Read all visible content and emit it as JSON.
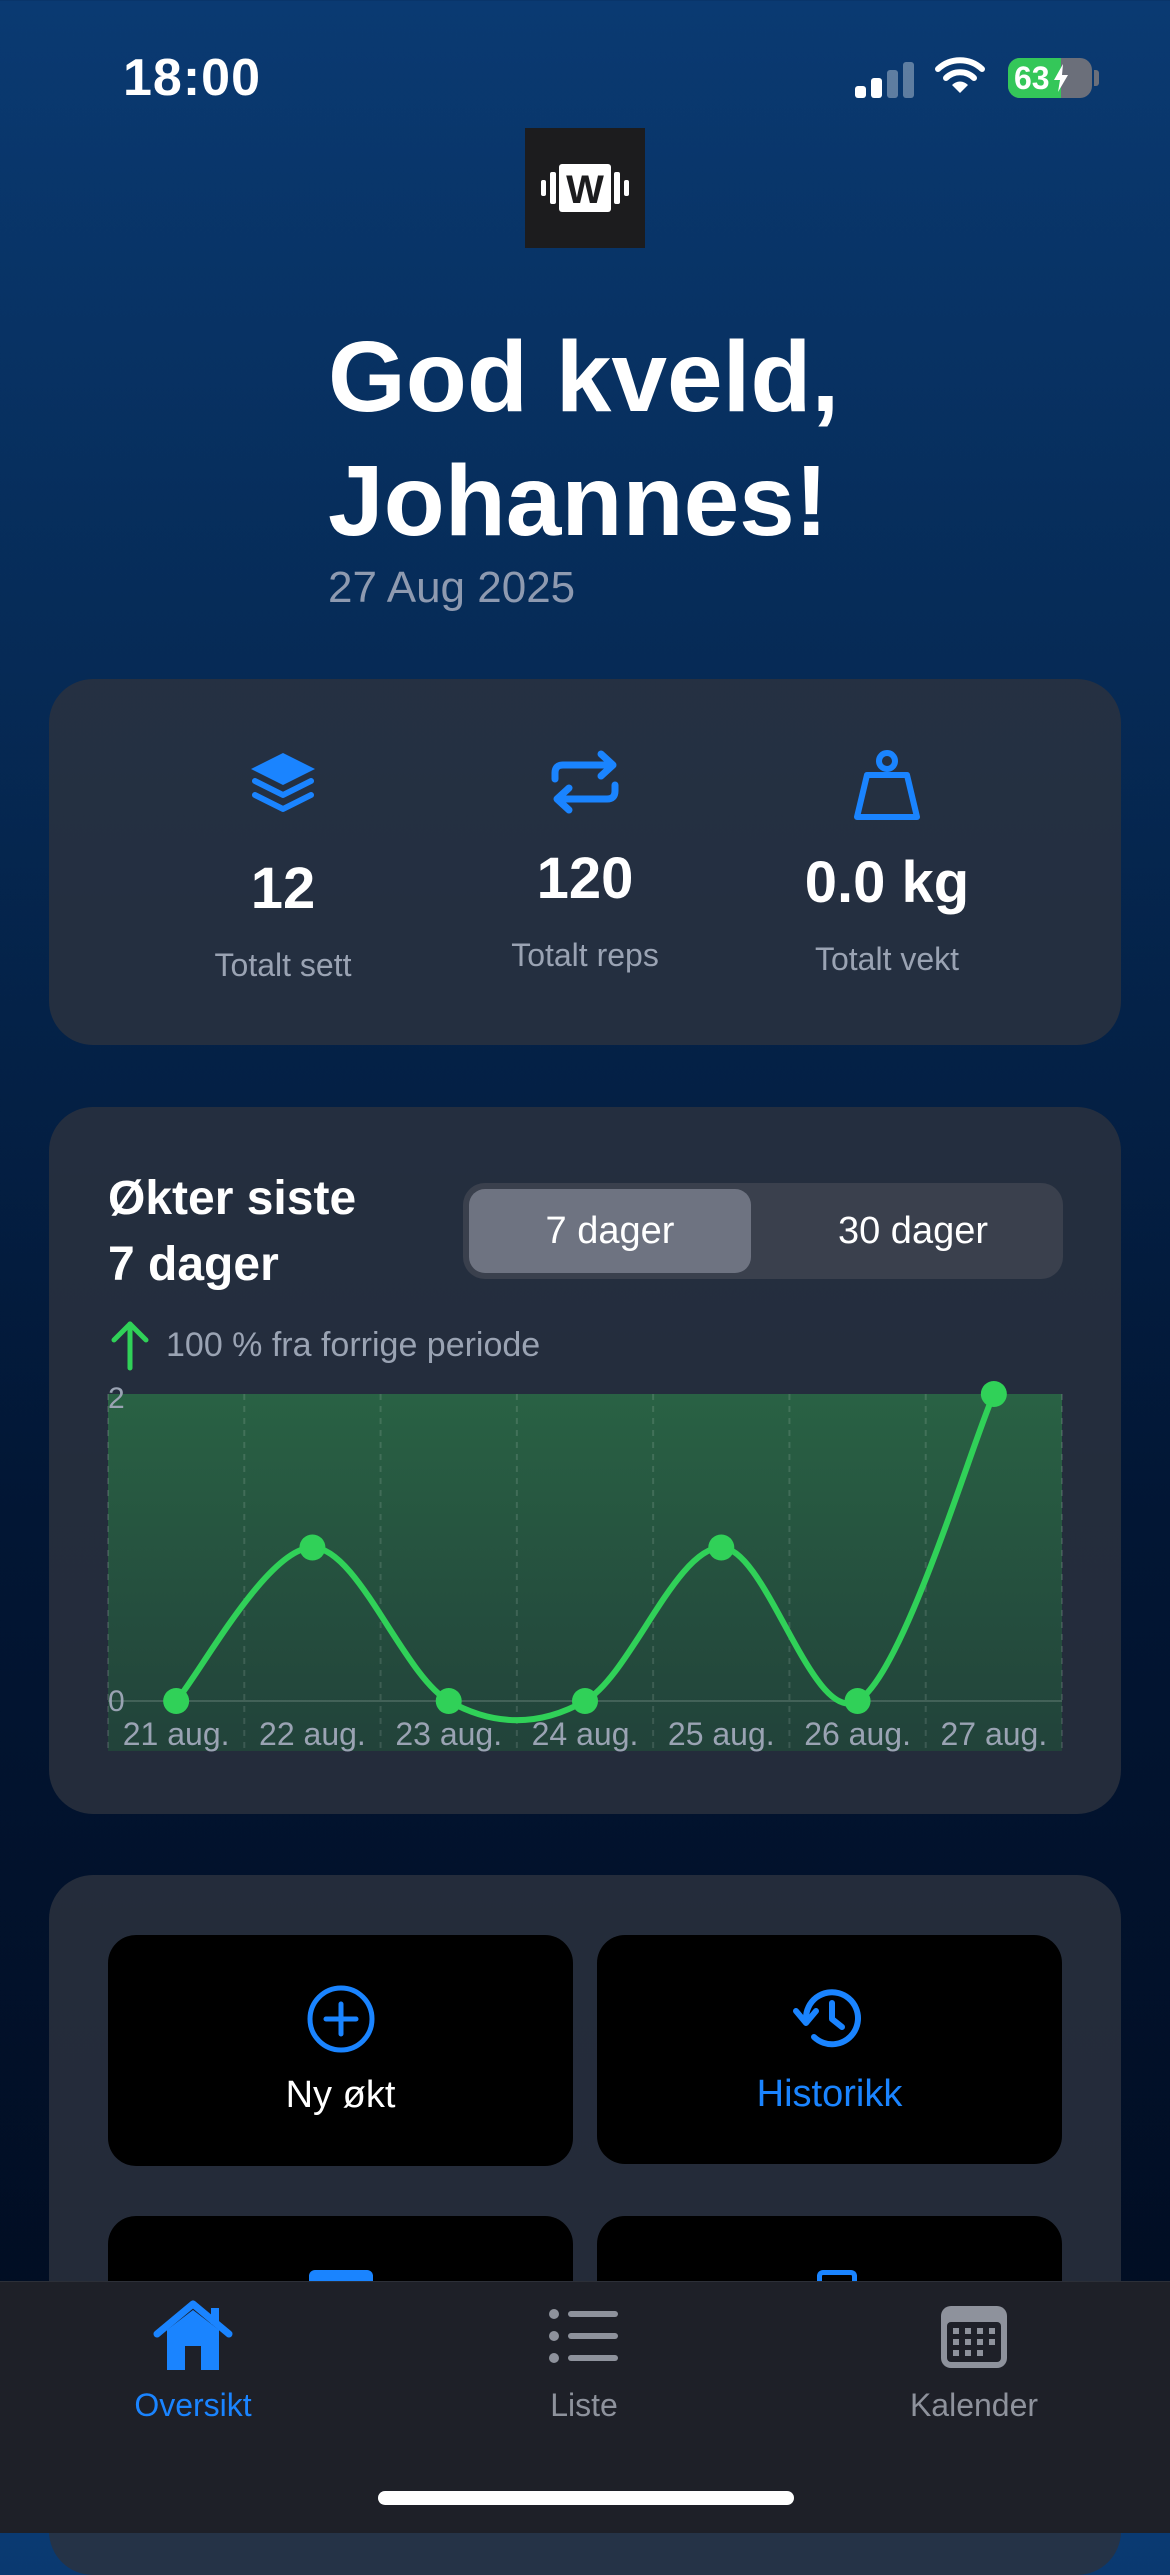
{
  "status_bar": {
    "time": "18:00",
    "battery_level": 63,
    "battery_text": "63",
    "signal_bars": 2
  },
  "logo": {
    "text": "W"
  },
  "greeting": {
    "line1": "God kveld,",
    "line2": "Johannes!",
    "date": "27 Aug 2025"
  },
  "stats": [
    {
      "icon": "layers-icon",
      "value": "12",
      "label": "Totalt sett"
    },
    {
      "icon": "repeat-icon",
      "value": "120",
      "label": "Totalt reps"
    },
    {
      "icon": "weight-icon",
      "value": "0.0 kg",
      "label": "Totalt vekt"
    }
  ],
  "sessions_chart": {
    "title_line1": "Økter siste",
    "title_line2": "7 dager",
    "segments": [
      "7 dager",
      "30 dager"
    ],
    "selected_segment": "7 dager",
    "trend_text": "100 % fra forrige periode"
  },
  "chart_data": {
    "type": "area",
    "categories": [
      "21 aug.",
      "22 aug.",
      "23 aug.",
      "24 aug.",
      "25 aug.",
      "26 aug.",
      "27 aug."
    ],
    "series": [
      {
        "values": [
          0,
          1,
          0,
          0,
          1,
          0,
          2
        ]
      }
    ],
    "y_tick_labels": [
      "0",
      "2"
    ],
    "ylim": [
      0,
      2
    ],
    "grid": true,
    "colors": {
      "line": "#30d158",
      "point": "#30d158"
    }
  },
  "actions": [
    {
      "icon": "plus-circle-icon",
      "label": "Ny økt"
    },
    {
      "icon": "history-icon",
      "label": "Historikk"
    }
  ],
  "tabs": [
    {
      "icon": "home-icon",
      "label": "Oversikt",
      "active": true
    },
    {
      "icon": "list-icon",
      "label": "Liste",
      "active": false
    },
    {
      "icon": "calendar-icon",
      "label": "Kalender",
      "active": false
    }
  ],
  "colors": {
    "accent": "#1a84ff",
    "positive": "#30d158",
    "muted": "#9aa3b3"
  }
}
